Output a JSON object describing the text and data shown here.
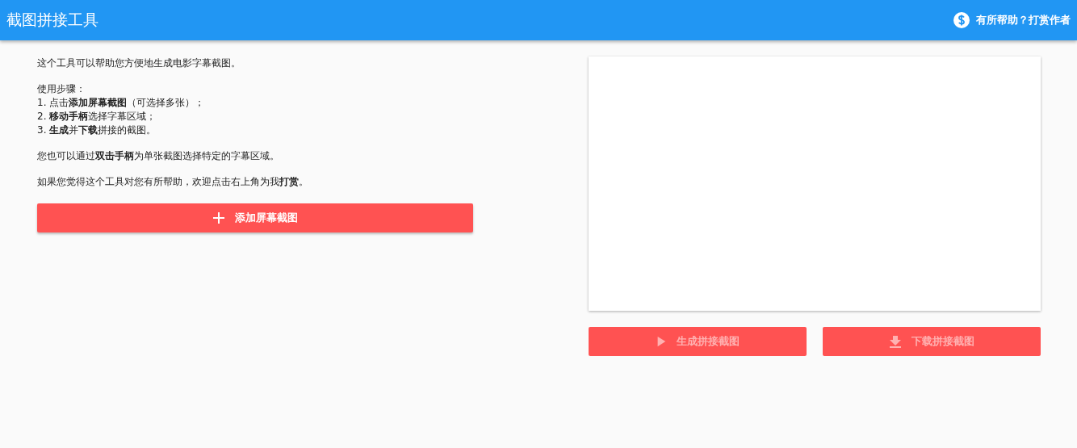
{
  "header": {
    "title": "截图拼接工具",
    "donate_link": "有所帮助？打赏作者"
  },
  "intro": {
    "paragraphs": [
      {
        "lines": [
          "这个工具可以帮助您方便地生成电影字幕截图。"
        ]
      },
      {
        "lines": [
          "使用步骤：",
          "1. 点击**添加屏幕截图**（可选择多张）；",
          "2. **移动手柄**选择字幕区域；",
          "3. **生成**并**下载**拼接的截图。"
        ]
      },
      {
        "lines": [
          "您也可以通过**双击手柄**为单张截图选择特定的字幕区域。"
        ]
      },
      {
        "lines": [
          "如果您觉得这个工具对您有所帮助，欢迎点击右上角为我**打赏**。"
        ]
      }
    ]
  },
  "add_button": {
    "label": "添加屏幕截图",
    "disabled": false
  },
  "actions": [
    {
      "kind": "generate",
      "label": "生成拼接截图",
      "disabled": true
    },
    {
      "kind": "download",
      "label": "下载拼接截图",
      "disabled": true
    }
  ]
}
